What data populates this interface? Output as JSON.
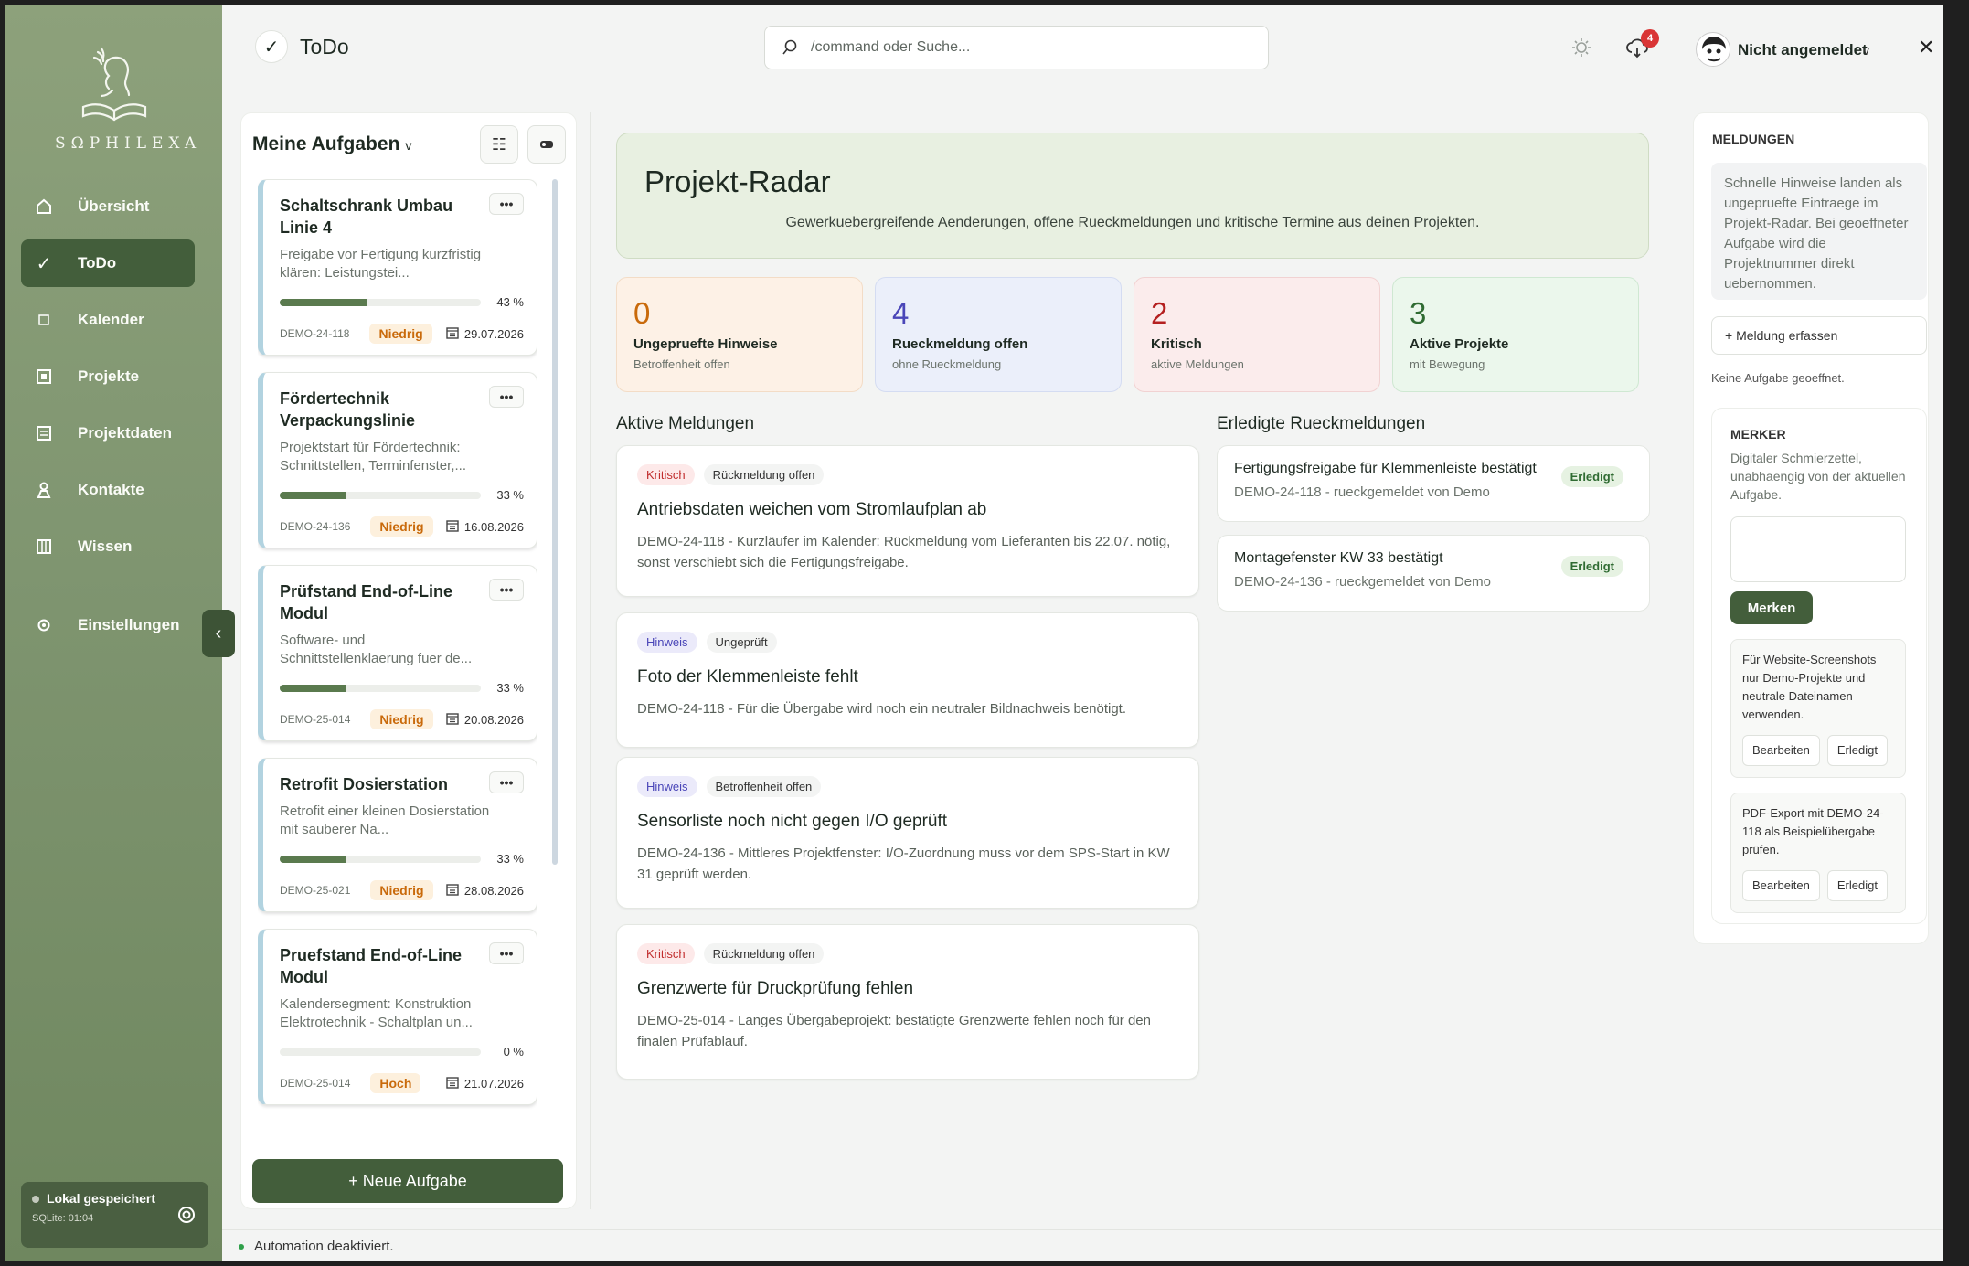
{
  "brand": {
    "name": "SΩPHILEXA"
  },
  "sidebar": {
    "items": [
      {
        "label": "Übersicht",
        "icon": "home-icon"
      },
      {
        "label": "ToDo",
        "icon": "check-icon"
      },
      {
        "label": "Kalender",
        "icon": "square-icon"
      },
      {
        "label": "Projekte",
        "icon": "project-icon"
      },
      {
        "label": "Projektdaten",
        "icon": "list-icon"
      },
      {
        "label": "Kontakte",
        "icon": "person-icon"
      },
      {
        "label": "Wissen",
        "icon": "book-icon"
      }
    ],
    "settings": "Einstellungen",
    "save_status": "Lokal gespeichert",
    "save_sub": "SQLite: 01:04"
  },
  "topbar": {
    "title": "ToDo",
    "search_placeholder": "/command oder Suche...",
    "notif_count": "4",
    "user": "Nicht angemeldet"
  },
  "tasks": {
    "heading": "Meine Aufgaben",
    "new_label": "+  Neue Aufgabe",
    "items": [
      {
        "title": "Schaltschrank Umbau Linie 4",
        "desc": "Freigabe vor Fertigung kurzfristig klären: Leistungstei...",
        "progress": 43,
        "pct": "43 %",
        "code": "DEMO-24-118",
        "prio": "Niedrig",
        "date": "29.07.2026"
      },
      {
        "title": "Fördertechnik Verpackungslinie",
        "desc": "Projektstart für Fördertechnik: Schnittstellen, Terminfenster,...",
        "progress": 33,
        "pct": "33 %",
        "code": "DEMO-24-136",
        "prio": "Niedrig",
        "date": "16.08.2026"
      },
      {
        "title": "Prüfstand End-of-Line Modul",
        "desc": "Software- und Schnittstellenklaerung fuer de...",
        "progress": 33,
        "pct": "33 %",
        "code": "DEMO-25-014",
        "prio": "Niedrig",
        "date": "20.08.2026"
      },
      {
        "title": "Retrofit Dosierstation",
        "desc": "Retrofit einer kleinen Dosierstation mit sauberer Na...",
        "progress": 33,
        "pct": "33 %",
        "code": "DEMO-25-021",
        "prio": "Niedrig",
        "date": "28.08.2026"
      },
      {
        "title": "Pruefstand End-of-Line Modul",
        "desc": "Kalendersegment: Konstruktion Elektrotechnik - Schaltplan un...",
        "progress": 0,
        "pct": "0 %",
        "code": "DEMO-25-014",
        "prio": "Hoch",
        "date": "21.07.2026"
      }
    ]
  },
  "radar": {
    "title": "Projekt-Radar",
    "subtitle": "Gewerkuebergreifende Aenderungen, offene Rueckmeldungen und kritische Termine aus deinen Projekten.",
    "stats": [
      {
        "num": "0",
        "label": "Ungepruefte Hinweise",
        "sub": "Betroffenheit offen"
      },
      {
        "num": "4",
        "label": "Rueckmeldung offen",
        "sub": "ohne Rueckmeldung"
      },
      {
        "num": "2",
        "label": "Kritisch",
        "sub": "aktive Meldungen"
      },
      {
        "num": "3",
        "label": "Aktive Projekte",
        "sub": "mit Bewegung"
      }
    ],
    "active_heading": "Aktive Meldungen",
    "done_heading": "Erledigte Rueckmeldungen",
    "messages": [
      {
        "chip1": "Kritisch",
        "chip2": "Rückmeldung offen",
        "title": "Antriebsdaten weichen vom Stromlaufplan ab",
        "desc": "DEMO-24-118 - Kurzläufer im Kalender: Rückmeldung vom Lieferanten bis 22.07. nötig, sonst verschiebt sich die Fertigungsfreigabe."
      },
      {
        "chip1": "Hinweis",
        "chip2": "Ungeprüft",
        "title": "Foto der Klemmenleiste fehlt",
        "desc": "DEMO-24-118 - Für die Übergabe wird noch ein neutraler Bildnachweis benötigt."
      },
      {
        "chip1": "Hinweis",
        "chip2": "Betroffenheit offen",
        "title": "Sensorliste noch nicht gegen I/O geprüft",
        "desc": "DEMO-24-136 - Mittleres Projektfenster: I/O-Zuordnung muss vor dem SPS-Start in KW 31 geprüft werden."
      },
      {
        "chip1": "Kritisch",
        "chip2": "Rückmeldung offen",
        "title": "Grenzwerte für Druckprüfung fehlen",
        "desc": "DEMO-25-014 - Langes Übergabeprojekt: bestätigte Grenzwerte fehlen noch für den finalen Prüfablauf."
      }
    ],
    "done": [
      {
        "title": "Fertigungsfreigabe für Klemmenleiste bestätigt",
        "sub": "DEMO-24-118 - rueckgemeldet von Demo",
        "chip": "Erledigt"
      },
      {
        "title": "Montagefenster KW 33 bestätigt",
        "sub": "DEMO-24-136 - rueckgemeldet von Demo",
        "chip": "Erledigt"
      }
    ]
  },
  "meldungen": {
    "heading": "MELDUNGEN",
    "info": "Schnelle Hinweise landen als ungepruefte Eintraege im Projekt-Radar. Bei geoeffneter Aufgabe wird die Projektnummer direkt uebernommen.",
    "add_label": "+ Meldung erfassen",
    "none": "Keine Aufgabe geoeffnet."
  },
  "merker": {
    "heading": "MERKER",
    "sub": "Digitaler Schmierzettel, unabhaengig von der aktuellen Aufgabe.",
    "button": "Merken",
    "notes": [
      {
        "text": "Für Website-Screenshots nur Demo-Projekte und neutrale Dateinamen verwenden.",
        "edit": "Bearbeiten",
        "done": "Erledigt"
      },
      {
        "text": "PDF-Export mit DEMO-24-118 als Beispielübergabe prüfen.",
        "edit": "Bearbeiten",
        "done": "Erledigt"
      }
    ]
  },
  "status": {
    "text": "Automation deaktiviert."
  },
  "colors": {
    "accent": "#435e3b",
    "critical": "#c12d2d",
    "hint": "#4a46b8"
  }
}
